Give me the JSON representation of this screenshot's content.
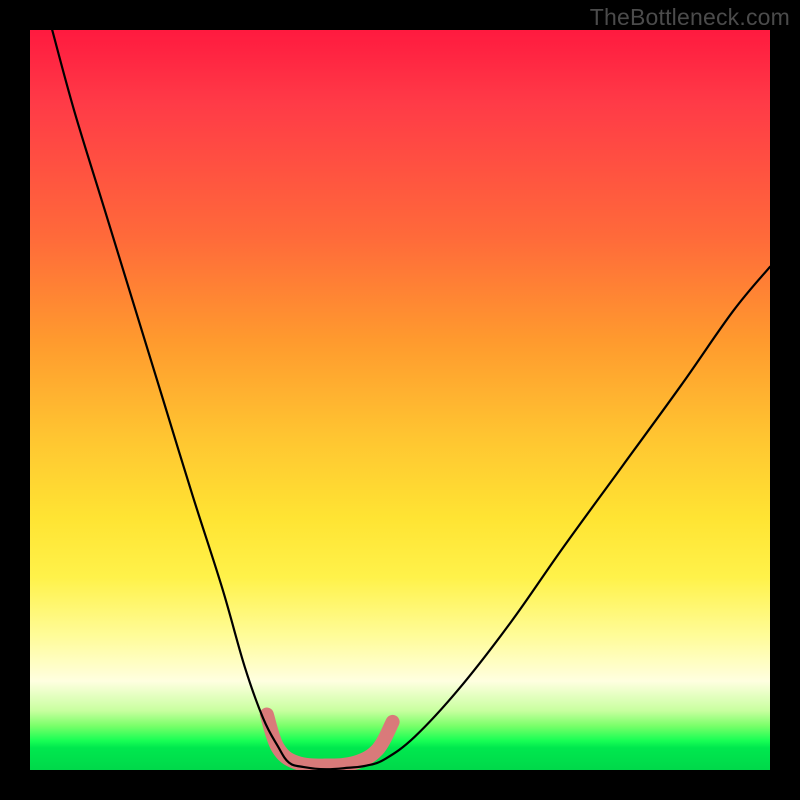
{
  "watermark": "TheBottleneck.com",
  "chart_data": {
    "type": "line",
    "title": "",
    "xlabel": "",
    "ylabel": "",
    "xlim": [
      0,
      100
    ],
    "ylim": [
      0,
      100
    ],
    "grid": false,
    "series": [
      {
        "name": "left-curve",
        "x": [
          3,
          6,
          10,
          14,
          18,
          22,
          26,
          29,
          31.5,
          33.5,
          35
        ],
        "y": [
          100,
          89,
          76,
          63,
          50,
          37,
          24.5,
          14,
          7,
          3.2,
          1.0
        ]
      },
      {
        "name": "valley-floor",
        "x": [
          35,
          37,
          40,
          43,
          45.5,
          48
        ],
        "y": [
          1.0,
          0.4,
          0.1,
          0.3,
          0.6,
          1.5
        ]
      },
      {
        "name": "right-curve",
        "x": [
          48,
          52,
          58,
          65,
          72,
          80,
          88,
          95,
          100
        ],
        "y": [
          1.5,
          4.5,
          11,
          20,
          30,
          41,
          52,
          62,
          68
        ]
      },
      {
        "name": "highlight-band",
        "x": [
          32,
          33.5,
          36,
          40,
          44,
          47,
          49
        ],
        "y": [
          7.5,
          3.0,
          1.0,
          0.6,
          1.0,
          2.8,
          6.5
        ]
      }
    ],
    "colors": {
      "curve": "#000000",
      "highlight": "#d97a7a"
    }
  }
}
